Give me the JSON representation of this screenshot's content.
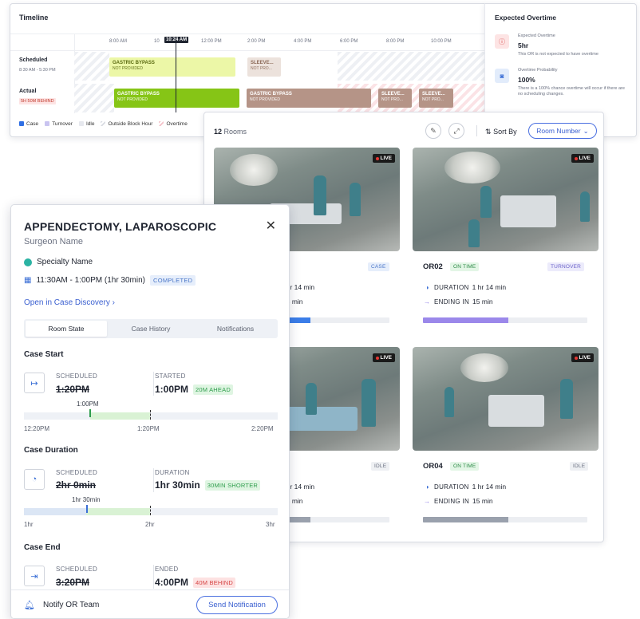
{
  "timeline": {
    "title": "Timeline",
    "hours": [
      "8:00 AM",
      "10",
      "12:00 PM",
      "2:00 PM",
      "4:00 PM",
      "6:00 PM",
      "8:00 PM",
      "10:00 PM"
    ],
    "now": "10:24 AM",
    "scheduled": {
      "label": "Scheduled",
      "sub": "8:30 AM - 5:30 PM",
      "blocks": [
        {
          "title": "GASTRIC BYPASS",
          "sub": "NOT PROVIDED"
        },
        {
          "title": "SLEEVE...",
          "sub": "NOT PRO..."
        }
      ]
    },
    "actual": {
      "label": "Actual",
      "sub": "5H 50M BEHIND",
      "blocks": [
        {
          "title": "GASTRIC BYPASS",
          "sub": "NOT PROVIDED"
        },
        {
          "title": "GASTRIC BYPASS",
          "sub": "NOT PROVIDED"
        },
        {
          "title": "SLEEVE...",
          "sub": "NOT PRO..."
        },
        {
          "title": "SLEEVE...",
          "sub": "NOT PRO..."
        }
      ]
    },
    "legend": [
      "Case",
      "Turnover",
      "Idle",
      "Outside Block Hour",
      "Overtime"
    ],
    "colors": {
      "case": "#2f6fe4",
      "turnover": "#c9c4f0",
      "idle": "#e6e8ee",
      "outside": "#eef0f4",
      "overtime": "#fbe3e6"
    }
  },
  "overtime": {
    "title": "Expected Overtime",
    "items": [
      {
        "label": "Expected Overtime",
        "value": "5hr",
        "desc": "This OR is not expected to have overtime"
      },
      {
        "label": "Overtime Probability",
        "value": "100%",
        "desc": "There is a 100% chance overtime will occur if there are no scheduling changes."
      }
    ]
  },
  "rooms": {
    "count": "12",
    "count_label": "Rooms",
    "sort_label": "Sort By",
    "sort_value": "Room Number",
    "live_label": "LIVE",
    "duration_label": "DURATION",
    "ending_label": "ENDING IN",
    "cards": [
      {
        "name": "",
        "status": "",
        "state": "CASE",
        "duration": "1hr 14 min",
        "ending": "15 min",
        "progress": 0.55,
        "bar_color": "#3b7de8"
      },
      {
        "name": "OR02",
        "status": "ON TIME",
        "state": "TURNOVER",
        "duration": "1 hr 14 min",
        "ending": "15 min",
        "progress": 0.52,
        "bar_color": "#9b88ea"
      },
      {
        "name": "",
        "status": "",
        "state": "IDLE",
        "duration": "1hr 14 min",
        "ending": "15 min",
        "progress": 0.55,
        "bar_color": "#9aa1ad"
      },
      {
        "name": "OR04",
        "status": "ON TIME",
        "state": "IDLE",
        "duration": "1 hr 14 min",
        "ending": "15 min",
        "progress": 0.52,
        "bar_color": "#9aa1ad"
      }
    ]
  },
  "case": {
    "title": "APPENDECTOMY, LAPAROSCOPIC",
    "surgeon": "Surgeon Name",
    "specialty": "Specialty Name",
    "time": "11:30AM - 1:00PM (1hr 30min)",
    "status": "COMPLETED",
    "link": "Open in Case Discovery",
    "tabs": [
      "Room State",
      "Case History",
      "Notifications"
    ],
    "start": {
      "title": "Case Start",
      "scheduled_label": "SCHEDULED",
      "scheduled": "1:20PM",
      "actual_label": "STARTED",
      "actual": "1:00PM",
      "delta": "20M AHEAD",
      "marker": "1:00PM",
      "axis": [
        "12:20PM",
        "1:20PM",
        "2:20PM"
      ]
    },
    "duration": {
      "title": "Case Duration",
      "scheduled_label": "SCHEDULED",
      "scheduled": "2hr 0min",
      "actual_label": "DURATION",
      "actual": "1hr 30min",
      "delta": "30MIN SHORTER",
      "marker": "1hr 30min",
      "axis": [
        "1hr",
        "2hr",
        "3hr"
      ]
    },
    "end": {
      "title": "Case End",
      "scheduled_label": "SCHEDULED",
      "scheduled": "3:20PM",
      "actual_label": "ENDED",
      "actual": "4:00PM",
      "delta": "40M BEHIND"
    },
    "notify_label": "Notify OR Team",
    "send_label": "Send Notification"
  }
}
